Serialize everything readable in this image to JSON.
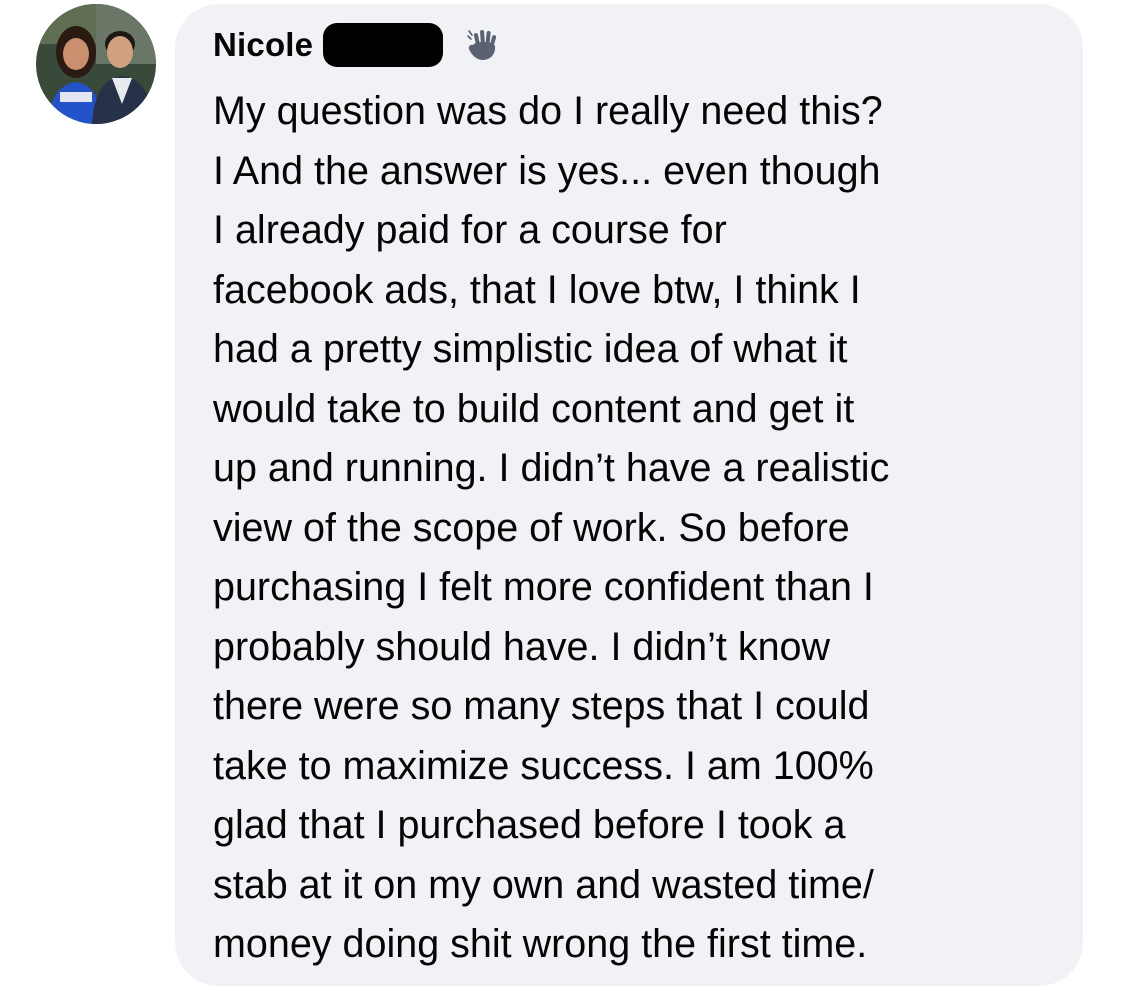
{
  "comment": {
    "author_name": "Nicole",
    "author_badge_icon": "wave-hand-icon",
    "text_lines": [
      "My question was do I really need this?",
      "I And the answer is yes... even though",
      "I already paid for a course for",
      "facebook ads, that I love btw, I think I",
      "had a pretty simplistic idea of what it",
      "would take to build content and get it",
      "up and running. I didn’t have a realistic",
      "view of the scope of work. So before",
      "purchasing I felt more confident than I",
      "probably should have. I didn’t know",
      "there were so many steps that I could",
      "take to maximize success. I am 100%",
      "glad that I purchased before I took a",
      "stab at it on my own and wasted time/",
      "money doing shit wrong the first time."
    ]
  },
  "colors": {
    "bubble_background": "#f0f2f5",
    "text": "#050505",
    "redaction": "#000000"
  }
}
